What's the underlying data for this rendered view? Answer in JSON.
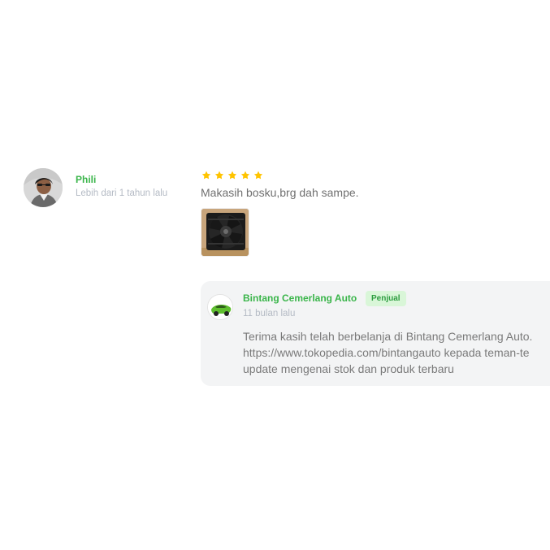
{
  "review": {
    "reviewer": {
      "name": "Phili",
      "time": "Lebih dari 1 tahun lalu"
    },
    "rating": {
      "stars": 5,
      "star_color": "#ffc400"
    },
    "text": "Makasih bosku,brg dah sampe."
  },
  "reply": {
    "seller_name": "Bintang Cemerlang Auto",
    "seller_badge": "Penjual",
    "time": "11 bulan lalu",
    "text_lines": [
      "Terima kasih telah berbelanja di Bintang Cemerlang Auto.",
      "https://www.tokopedia.com/bintangauto kepada teman-te",
      "update mengenai stok dan produk terbaru"
    ]
  },
  "colors": {
    "green": "#3ab54a",
    "muted_text": "#b5bbc5",
    "body_text": "#707070",
    "reply_background": "#f3f4f5",
    "badge_background": "#d9f6d8"
  },
  "icons": {
    "star": "star-icon",
    "reviewer_avatar": "avatar-image",
    "review_photo": "product-photo",
    "seller_avatar": "seller-avatar-image"
  }
}
